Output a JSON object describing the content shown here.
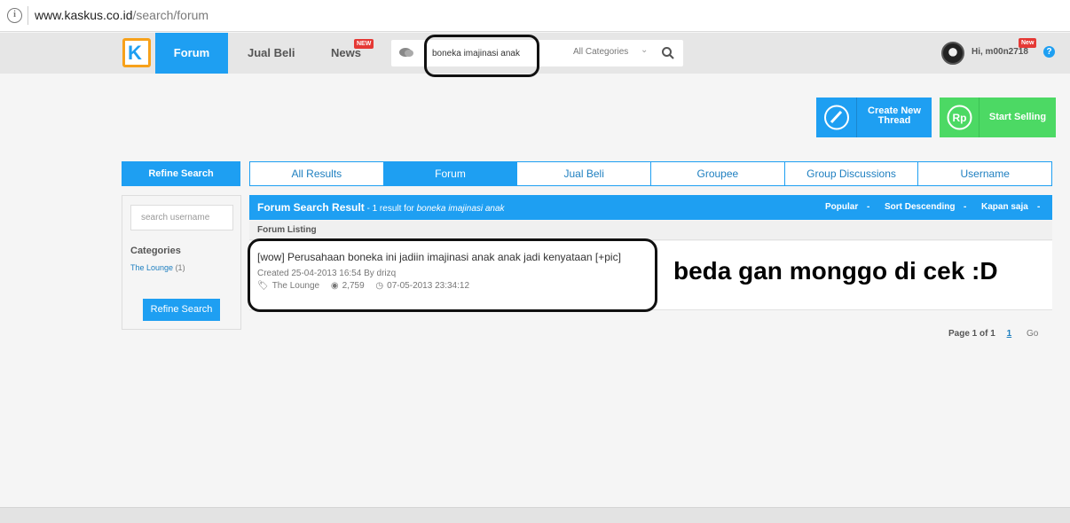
{
  "browser": {
    "url_host": "www.kaskus.co.id",
    "url_path": "/search/forum"
  },
  "nav": {
    "logo": "K",
    "forum": "Forum",
    "jual_beli": "Jual Beli",
    "news": "News",
    "news_badge": "NEW",
    "search_value": "boneka imajinasi anak",
    "category": "All Categories",
    "greeting": "Hi, m00n2718",
    "greeting_badge": "New",
    "help": "?"
  },
  "actions": {
    "create_thread": "Create New Thread",
    "start_selling": "Start Selling",
    "rp_label": "Rp"
  },
  "sidebar": {
    "header": "Refine Search",
    "username_placeholder": "search username",
    "categories_title": "Categories",
    "category_name": "The Lounge",
    "category_count": "(1)",
    "button": "Refine Search"
  },
  "tabs": [
    "All Results",
    "Forum",
    "Jual Beli",
    "Groupee",
    "Group Discussions",
    "Username"
  ],
  "results": {
    "title": "Forum Search Result",
    "summary_prefix": " - 1 result for ",
    "query": "boneka imajinasi anak",
    "sort_popular": "Popular",
    "sort_order": "Sort Descending",
    "sort_time": "Kapan saja",
    "listing_label": "Forum Listing",
    "thread": {
      "title": "[wow] Perusahaan boneka ini jadiin imajinasi anak anak jadi kenyataan [+pic]",
      "created": "Created 25-04-2013 16:54 By drizq",
      "category": "The Lounge",
      "views": "2,759",
      "last_post": "07-05-2013 23:34:12"
    }
  },
  "annotation": "beda gan monggo di cek :D",
  "pagination": {
    "label": "Page 1 of 1",
    "current": "1",
    "go": "Go"
  },
  "colors": {
    "primary": "#1e9ff2",
    "sell_green": "#4cd964",
    "logo_orange": "#f7a11a",
    "badge_red": "#e53935"
  }
}
